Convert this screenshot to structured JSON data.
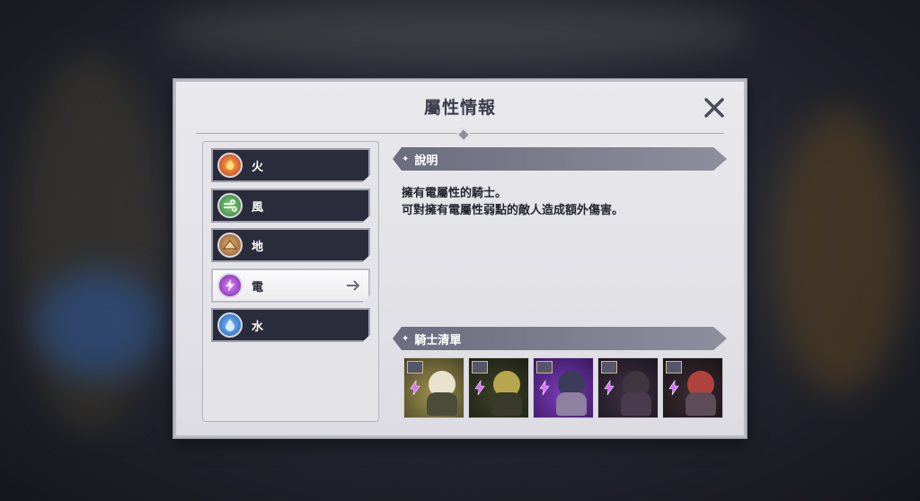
{
  "dialog": {
    "title": "屬性情報",
    "close_icon": "close-icon"
  },
  "elements": [
    {
      "label": "火",
      "icon": "fire-icon",
      "color": "#d8402a"
    },
    {
      "label": "風",
      "icon": "wind-icon",
      "color": "#3f9a44"
    },
    {
      "label": "地",
      "icon": "earth-icon",
      "color": "#a86f3c"
    },
    {
      "label": "電",
      "icon": "lightning-icon",
      "color": "#a43ad6",
      "selected": true
    },
    {
      "label": "水",
      "icon": "water-icon",
      "color": "#2c7fd3"
    }
  ],
  "description": {
    "header": "說明",
    "lines": [
      "擁有電屬性的騎士。",
      "可對擁有電屬性弱點的敵人造成額外傷害。"
    ]
  },
  "knights_section": {
    "header": "騎士清單",
    "knights": [
      {
        "name": "knight-portrait-1",
        "bg": "#6f6a3a",
        "hair": "#e8e2cf",
        "body": "#4b4b3a"
      },
      {
        "name": "knight-portrait-2",
        "bg": "#2d3020",
        "hair": "#b8a64c",
        "body": "#3a3a2a"
      },
      {
        "name": "knight-portrait-3",
        "bg": "#5b2a8a",
        "hair": "#3a3c5a",
        "body": "#8e80a0"
      },
      {
        "name": "knight-portrait-4",
        "bg": "#2e2433",
        "hair": "#403640",
        "body": "#4a3a4e"
      },
      {
        "name": "knight-portrait-5",
        "bg": "#2a2026",
        "hair": "#b2423e",
        "body": "#5c4c58"
      }
    ]
  }
}
